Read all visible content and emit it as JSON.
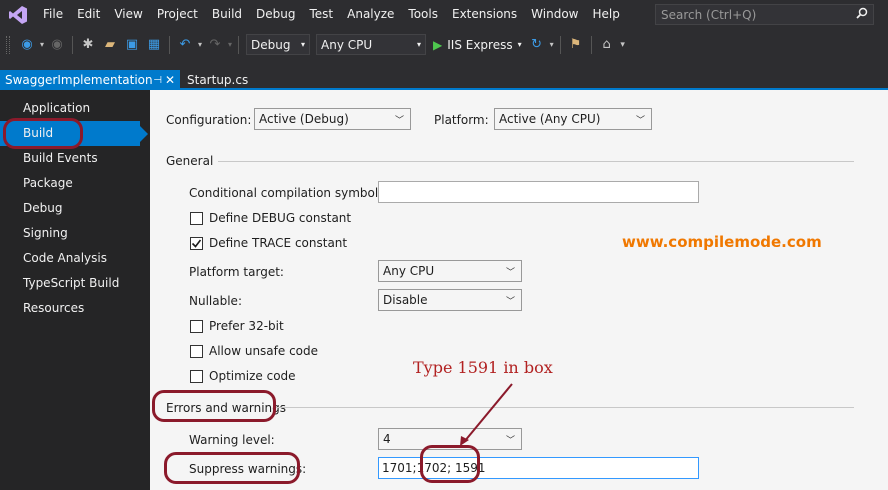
{
  "menubar": {
    "items": [
      "File",
      "Edit",
      "View",
      "Project",
      "Build",
      "Debug",
      "Test",
      "Analyze",
      "Tools",
      "Extensions",
      "Window",
      "Help"
    ],
    "search_placeholder": "Search (Ctrl+Q)"
  },
  "toolbar": {
    "config": "Debug",
    "platform": "Any CPU",
    "run_label": "IIS Express"
  },
  "tabs": {
    "active": "SwaggerImplementation",
    "inactive": "Startup.cs"
  },
  "nav": {
    "items": [
      "Application",
      "Build",
      "Build Events",
      "Package",
      "Debug",
      "Signing",
      "Code Analysis",
      "TypeScript Build",
      "Resources"
    ],
    "selected": "Build"
  },
  "form": {
    "configuration_label": "Configuration:",
    "configuration_value": "Active (Debug)",
    "platform_label": "Platform:",
    "platform_value": "Active (Any CPU)",
    "general_header": "General",
    "cond_symbols_label": "Conditional compilation symbols:",
    "cond_symbols_value": "",
    "define_debug_label": "Define DEBUG constant",
    "define_debug_checked": false,
    "define_trace_label": "Define TRACE constant",
    "define_trace_checked": true,
    "platform_target_label": "Platform target:",
    "platform_target_value": "Any CPU",
    "nullable_label": "Nullable:",
    "nullable_value": "Disable",
    "prefer32_label": "Prefer 32-bit",
    "unsafe_label": "Allow unsafe code",
    "optimize_label": "Optimize code",
    "errors_header": "Errors and warnings",
    "warning_level_label": "Warning level:",
    "warning_level_value": "4",
    "suppress_label": "Suppress warnings:",
    "suppress_value": "1701;1702; 1591"
  },
  "annotations": {
    "watermark": "www.compilemode.com",
    "note": "Type 1591 in box",
    "ring_color": "#8b1a2b"
  },
  "colors": {
    "accent": "#007acc",
    "watermark": "#f07800",
    "note": "#b22222"
  }
}
